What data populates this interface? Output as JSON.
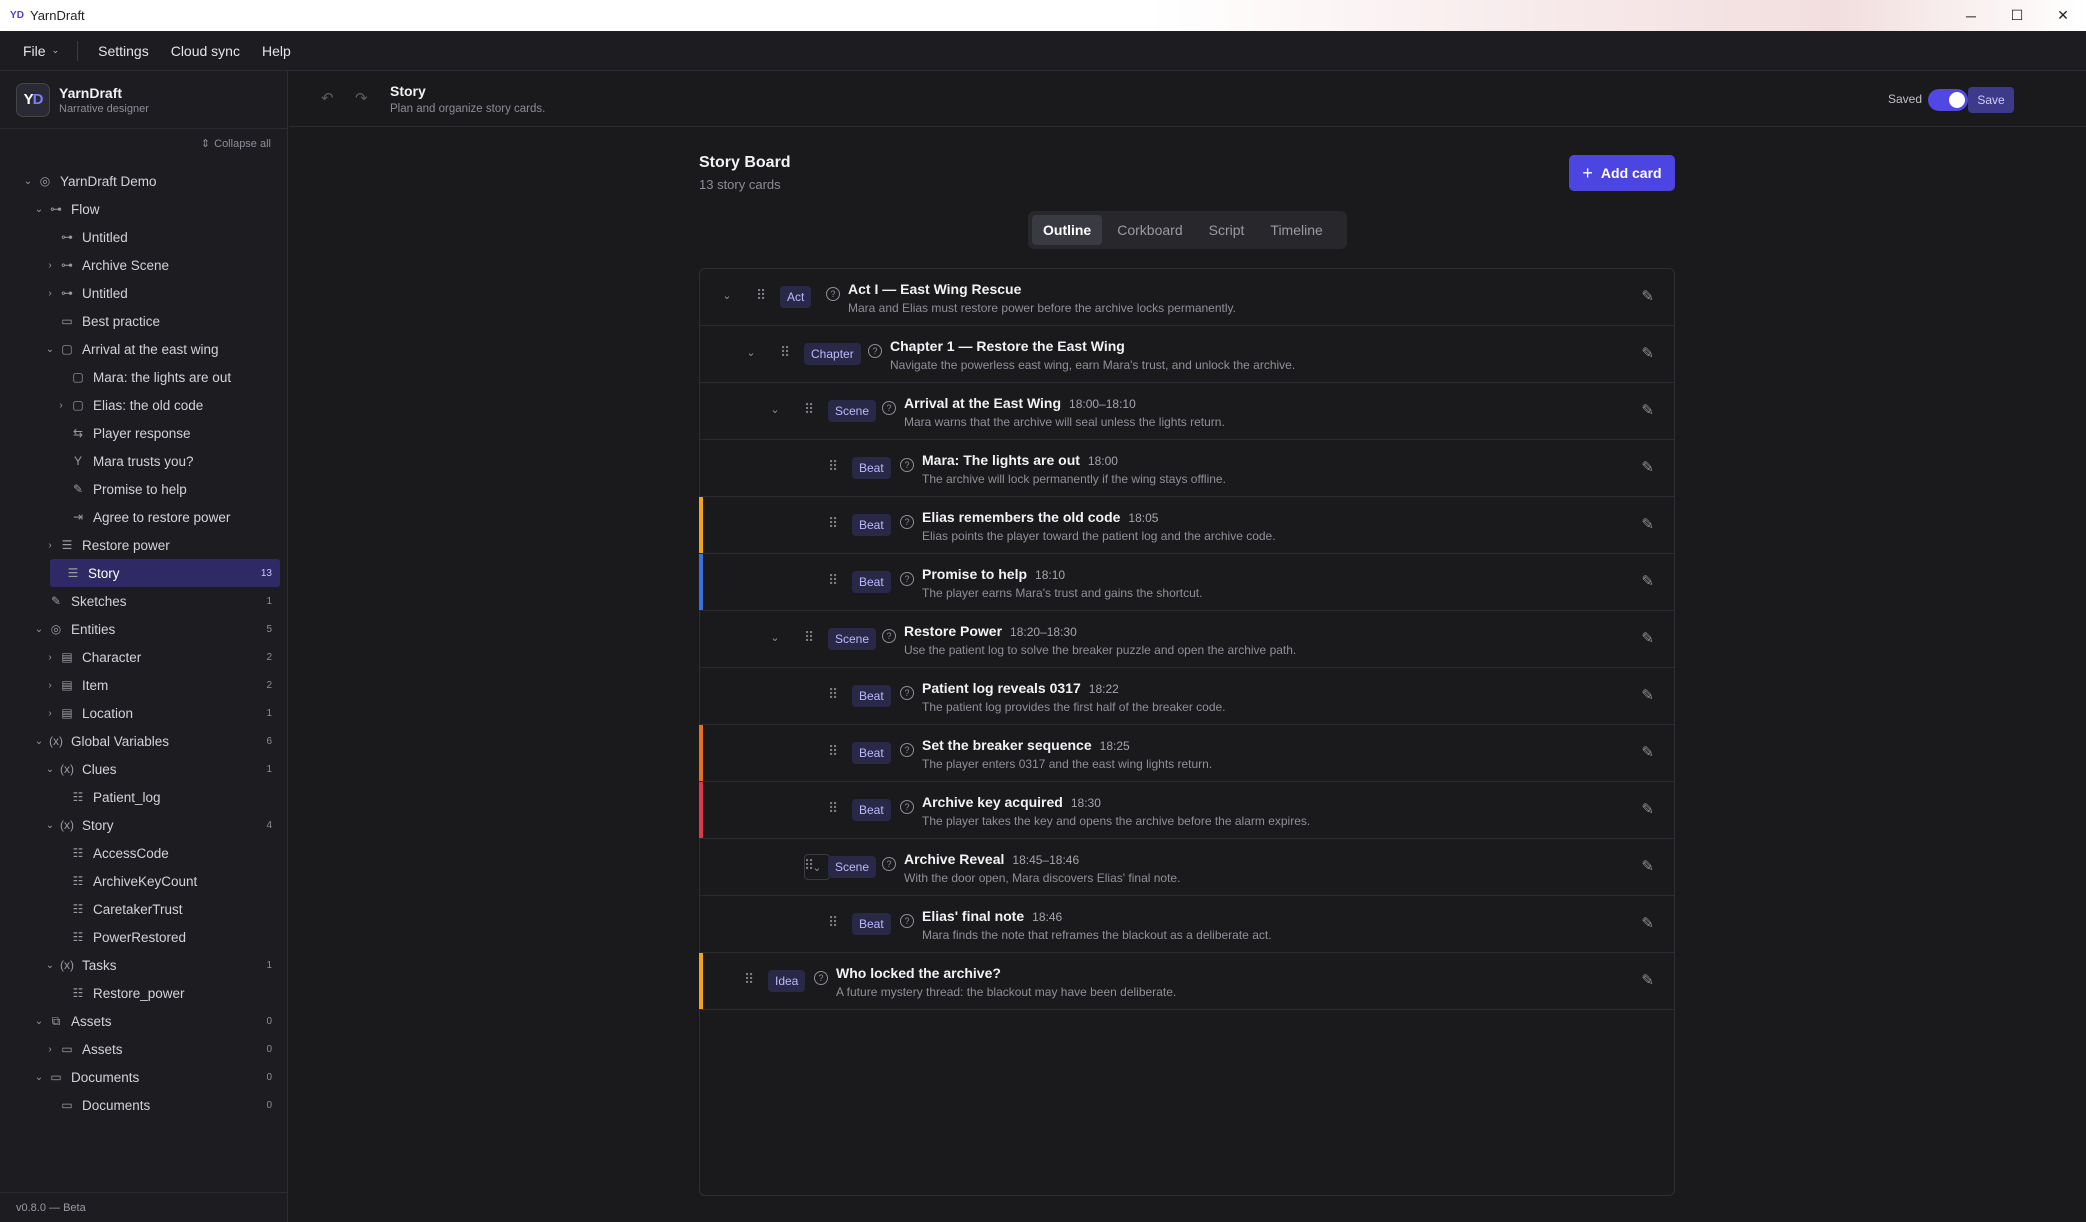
{
  "window": {
    "title": "YarnDraft",
    "logo": "YD",
    "min": "─",
    "max": "☐",
    "close": "✕"
  },
  "menu": {
    "file": "File",
    "settings": "Settings",
    "cloud_sync": "Cloud sync",
    "help": "Help"
  },
  "brand": {
    "logo": "YD",
    "name": "YarnDraft",
    "subtitle": "Narrative designer"
  },
  "sidebar": {
    "collapse_all": "Collapse all",
    "version": "v0.8.0 — Beta"
  },
  "tree": [
    {
      "label": "YarnDraft Demo",
      "depth": 0,
      "chev": "⌄",
      "icon": "◎"
    },
    {
      "label": "Flow",
      "depth": 1,
      "chev": "⌄",
      "icon": "⊶"
    },
    {
      "label": "Untitled",
      "depth": 2,
      "chev": "",
      "icon": "⊶"
    },
    {
      "label": "Archive Scene",
      "depth": 2,
      "chev": "›",
      "icon": "⊶"
    },
    {
      "label": "Untitled",
      "depth": 2,
      "chev": "›",
      "icon": "⊶"
    },
    {
      "label": "Best practice",
      "depth": 2,
      "chev": "",
      "icon": "▭"
    },
    {
      "label": "Arrival at the east wing",
      "depth": 2,
      "chev": "⌄",
      "icon": "▢"
    },
    {
      "label": "Mara: the lights are out",
      "depth": 3,
      "chev": "",
      "icon": "▢"
    },
    {
      "label": "Elias: the old code",
      "depth": 3,
      "chev": "›",
      "icon": "▢"
    },
    {
      "label": "Player response",
      "depth": 3,
      "chev": "",
      "icon": "⇆"
    },
    {
      "label": "Mara trusts you?",
      "depth": 3,
      "chev": "",
      "icon": "Y"
    },
    {
      "label": "Promise to help",
      "depth": 3,
      "chev": "",
      "icon": "✎"
    },
    {
      "label": "Agree to restore power",
      "depth": 3,
      "chev": "",
      "icon": "⇥"
    },
    {
      "label": "Restore power",
      "depth": 2,
      "chev": "›",
      "icon": "☰"
    },
    {
      "label": "Story",
      "depth": 1,
      "chev": "",
      "icon": "☰",
      "count": "13",
      "active": true
    },
    {
      "label": "Sketches",
      "depth": 1,
      "chev": "",
      "icon": "✎",
      "count": "1"
    },
    {
      "label": "Entities",
      "depth": 1,
      "chev": "⌄",
      "icon": "◎",
      "count": "5"
    },
    {
      "label": "Character",
      "depth": 2,
      "chev": "›",
      "icon": "▤",
      "count": "2"
    },
    {
      "label": "Item",
      "depth": 2,
      "chev": "›",
      "icon": "▤",
      "count": "2"
    },
    {
      "label": "Location",
      "depth": 2,
      "chev": "›",
      "icon": "▤",
      "count": "1"
    },
    {
      "label": "Global Variables",
      "depth": 1,
      "chev": "⌄",
      "icon": "(x)",
      "count": "6"
    },
    {
      "label": "Clues",
      "depth": 2,
      "chev": "⌄",
      "icon": "(x)",
      "count": "1"
    },
    {
      "label": "Patient_log",
      "depth": 3,
      "chev": "",
      "icon": "☷"
    },
    {
      "label": "Story",
      "depth": 2,
      "chev": "⌄",
      "icon": "(x)",
      "count": "4"
    },
    {
      "label": "AccessCode",
      "depth": 3,
      "chev": "",
      "icon": "☷"
    },
    {
      "label": "ArchiveKeyCount",
      "depth": 3,
      "chev": "",
      "icon": "☷"
    },
    {
      "label": "CaretakerTrust",
      "depth": 3,
      "chev": "",
      "icon": "☷"
    },
    {
      "label": "PowerRestored",
      "depth": 3,
      "chev": "",
      "icon": "☷"
    },
    {
      "label": "Tasks",
      "depth": 2,
      "chev": "⌄",
      "icon": "(x)",
      "count": "1"
    },
    {
      "label": "Restore_power",
      "depth": 3,
      "chev": "",
      "icon": "☷"
    },
    {
      "label": "Assets",
      "depth": 1,
      "chev": "⌄",
      "icon": "⧉",
      "count": "0"
    },
    {
      "label": "Assets",
      "depth": 2,
      "chev": "›",
      "icon": "▭",
      "count": "0"
    },
    {
      "label": "Documents",
      "depth": 1,
      "chev": "⌄",
      "icon": "▭",
      "count": "0"
    },
    {
      "label": "Documents",
      "depth": 2,
      "chev": "",
      "icon": "▭",
      "count": "0"
    }
  ],
  "header": {
    "undo": "↶",
    "redo": "↷",
    "title": "Story",
    "subtitle": "Plan and organize story cards.",
    "saved": "Saved",
    "save": "Save"
  },
  "board": {
    "title": "Story Board",
    "subtitle": "13 story cards",
    "add_card": "Add card",
    "add_icon": "+"
  },
  "tabs": [
    "Outline",
    "Corkboard",
    "Script",
    "Timeline"
  ],
  "active_tab": 0,
  "colors": {
    "accent": "#4d45e2",
    "yellow": "#f2a516",
    "blue": "#3b6fe0",
    "orange": "#e5711f",
    "red": "#e0384a"
  },
  "cards": [
    {
      "type": "Act",
      "level": 0,
      "title": "Act I — East Wing Rescue",
      "time": "",
      "desc": "Mara and Elias must restore power before the archive locks permanently.",
      "chev": true,
      "bar": ""
    },
    {
      "type": "Chapter",
      "level": 1,
      "title": "Chapter 1 — Restore the East Wing",
      "time": "",
      "desc": "Navigate the powerless east wing, earn Mara's trust, and unlock the archive.",
      "chev": true,
      "bar": ""
    },
    {
      "type": "Scene",
      "level": 2,
      "title": "Arrival at the East Wing",
      "time": "18:00–18:10",
      "desc": "Mara warns that the archive will seal unless the lights return.",
      "chev": true,
      "bar": ""
    },
    {
      "type": "Beat",
      "level": 3,
      "title": "Mara: The lights are out",
      "time": "18:00",
      "desc": "The archive will lock permanently if the wing stays offline.",
      "chev": false,
      "bar": ""
    },
    {
      "type": "Beat",
      "level": 3,
      "title": "Elias remembers the old code",
      "time": "18:05",
      "desc": "Elias points the player toward the patient log and the archive code.",
      "chev": false,
      "bar": "#f2a516"
    },
    {
      "type": "Beat",
      "level": 3,
      "title": "Promise to help",
      "time": "18:10",
      "desc": "The player earns Mara's trust and gains the shortcut.",
      "chev": false,
      "bar": "#3b6fe0"
    },
    {
      "type": "Scene",
      "level": 2,
      "title": "Restore Power",
      "time": "18:20–18:30",
      "desc": "Use the patient log to solve the breaker puzzle and open the archive path.",
      "chev": true,
      "bar": ""
    },
    {
      "type": "Beat",
      "level": 3,
      "title": "Patient log reveals 0317",
      "time": "18:22",
      "desc": "The patient log provides the first half of the breaker code.",
      "chev": false,
      "bar": ""
    },
    {
      "type": "Beat",
      "level": 3,
      "title": "Set the breaker sequence",
      "time": "18:25",
      "desc": "The player enters 0317 and the east wing lights return.",
      "chev": false,
      "bar": "#e5711f"
    },
    {
      "type": "Beat",
      "level": 3,
      "title": "Archive key acquired",
      "time": "18:30",
      "desc": "The player takes the key and opens the archive before the alarm expires.",
      "chev": false,
      "bar": "#e0384a"
    },
    {
      "type": "Scene",
      "level": 2,
      "title": "Archive Reveal",
      "time": "18:45–18:46",
      "desc": "With the door open, Mara discovers Elias' final note.",
      "chev": true,
      "chev_boxed": true,
      "bar": ""
    },
    {
      "type": "Beat",
      "level": 3,
      "title": "Elias' final note",
      "time": "18:46",
      "desc": "Mara finds the note that reframes the blackout as a deliberate act.",
      "chev": false,
      "bar": ""
    },
    {
      "type": "Idea",
      "level": 0,
      "title": "Who locked the archive?",
      "time": "",
      "desc": "A future mystery thread: the blackout may have been deliberate.",
      "chev": false,
      "bar": "#f2a516"
    }
  ]
}
